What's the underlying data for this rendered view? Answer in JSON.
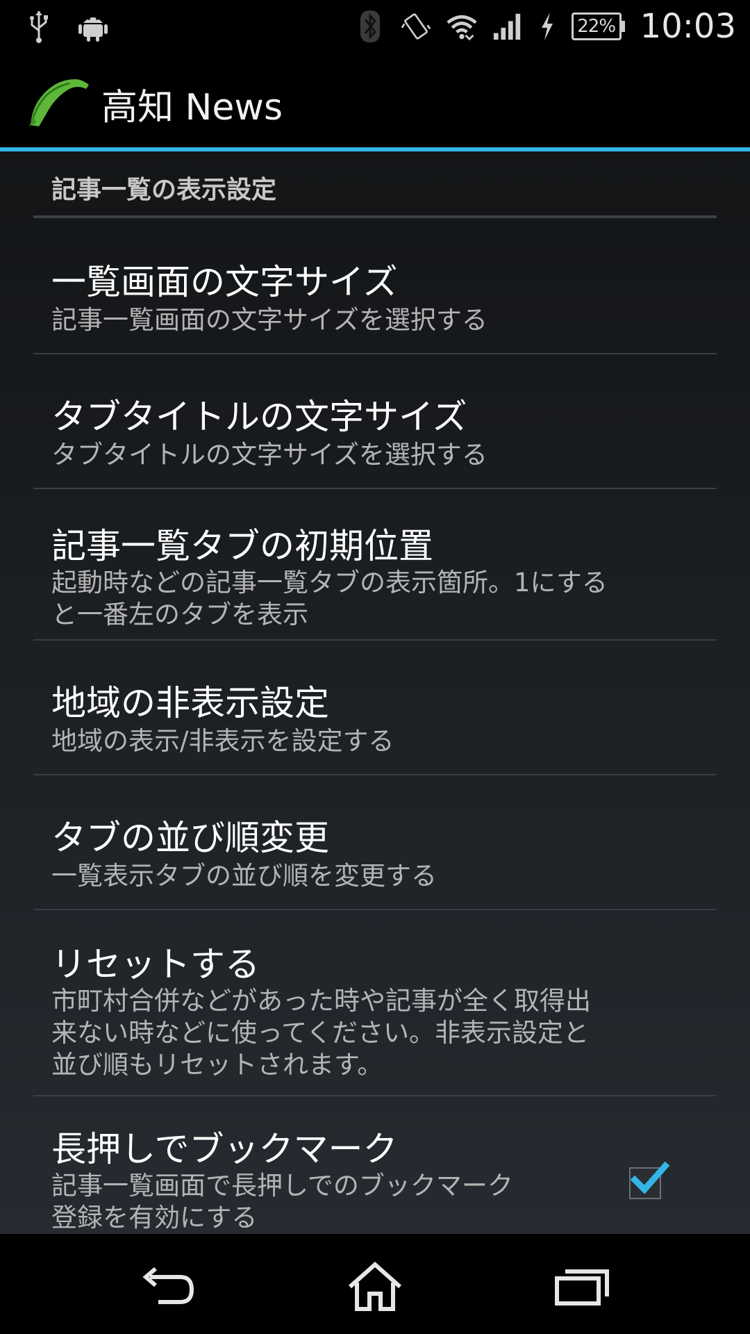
{
  "status_bar": {
    "battery_percent": "22%",
    "time": "10:03",
    "icons": [
      "usb-icon",
      "android-icon",
      "bluetooth-icon",
      "vibrate-icon",
      "wifi-icon",
      "signal-icon",
      "charging-icon",
      "battery-icon"
    ]
  },
  "app_bar": {
    "title": "高知 News",
    "logo_icon": "kochi-map-logo-icon",
    "accent_color": "#33b5e5"
  },
  "section": {
    "header": "記事一覧の表示設定"
  },
  "settings": [
    {
      "title": "一覧画面の文字サイズ",
      "summary": "記事一覧画面の文字サイズを選択する"
    },
    {
      "title": "タブタイトルの文字サイズ",
      "summary": "タブタイトルの文字サイズを選択する"
    },
    {
      "title": "記事一覧タブの初期位置",
      "summary_lines": [
        "起動時などの記事一覧タブの表示箇所。1にする",
        "と一番左のタブを表示"
      ]
    },
    {
      "title": "地域の非表示設定",
      "summary": "地域の表示/非表示を設定する"
    },
    {
      "title": "タブの並び順変更",
      "summary": "一覧表示タブの並び順を変更する"
    },
    {
      "title": "リセットする",
      "summary_lines": [
        "市町村合併などがあった時や記事が全く取得出",
        "来ない時などに使ってください。非表示設定と",
        "並び順もリセットされます。"
      ]
    },
    {
      "title": "長押しでブックマーク",
      "summary_lines": [
        "記事一覧画面で長押しでのブックマーク",
        "登録を有効にする"
      ],
      "checked": true
    }
  ],
  "nav_bar": {
    "buttons": [
      "back-icon",
      "home-icon",
      "recents-icon"
    ]
  }
}
